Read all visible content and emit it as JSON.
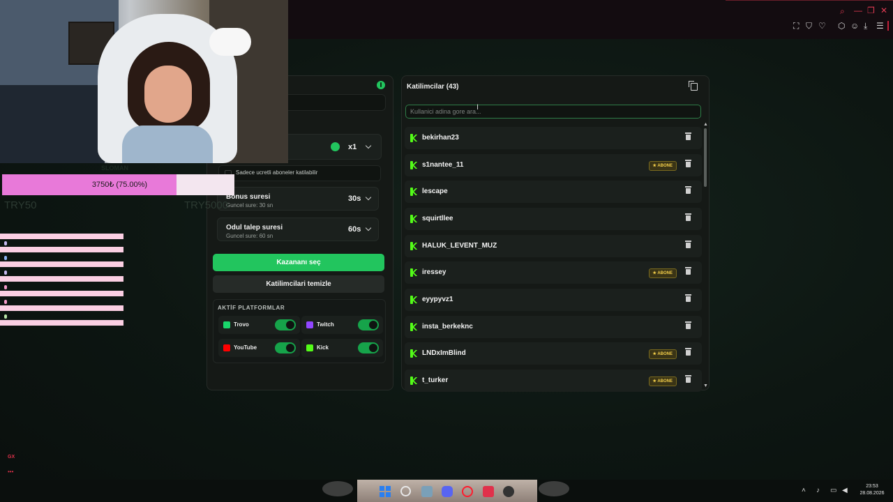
{
  "participants": {
    "title": "Katilimcilar (43)",
    "search_placeholder": "Kullanici adina gore ara...",
    "items": [
      {
        "name": "bekirhan23",
        "badge": ""
      },
      {
        "name": "s1nantee_11",
        "badge": "★ ABONE"
      },
      {
        "name": "lescape",
        "badge": ""
      },
      {
        "name": "squirtllee",
        "badge": ""
      },
      {
        "name": "HALUK_LEVENT_MUZ",
        "badge": ""
      },
      {
        "name": "iressey",
        "badge": "★ ABONE"
      },
      {
        "name": "eyypyvz1",
        "badge": ""
      },
      {
        "name": "insta_berkeknc",
        "badge": ""
      },
      {
        "name": "LNDxImBlind",
        "badge": "★ ABONE"
      },
      {
        "name": "t_turker",
        "badge": "★ ABONE"
      }
    ]
  },
  "settings": {
    "multiplier": "x1",
    "subscribers_only": "Sadece ucretli aboneler katilabilir",
    "bonus_title": "Bonus suresi",
    "bonus_sub": "Guncel sure: 30 sn",
    "bonus_value": "30s",
    "claim_title": "Odul talep suresi",
    "claim_sub": "Guncel sure: 60 sn",
    "claim_value": "60s",
    "pick_winner": "Kazananı seç",
    "clear_participants": "Katilimcilari temizle",
    "platforms_title": "AKTİF PLATFORMLAR",
    "platforms": [
      {
        "name": "Trovo",
        "color": "#19d66b",
        "enabled": true
      },
      {
        "name": "Twitch",
        "color": "#9146ff",
        "enabled": true
      },
      {
        "name": "YouTube",
        "color": "#ff0000",
        "enabled": true
      },
      {
        "name": "Kick",
        "color": "#53fc18",
        "enabled": true
      }
    ]
  },
  "overlay": {
    "goal_label": "SLOMAN",
    "goal_text": "3750₺ (75.00%)",
    "goal_progress": 0.75,
    "goal_min": "TRY50",
    "goal_max": "TRY5000"
  },
  "sidebar": {
    "gx": "GX",
    "more": "•••"
  },
  "taskbar": {
    "time": "23:53",
    "date": "28.08.2026"
  },
  "colors": {
    "accent": "#22c55e",
    "kick": "#53fc18",
    "badge": "#f5d04a",
    "goal": "#e879d9"
  }
}
